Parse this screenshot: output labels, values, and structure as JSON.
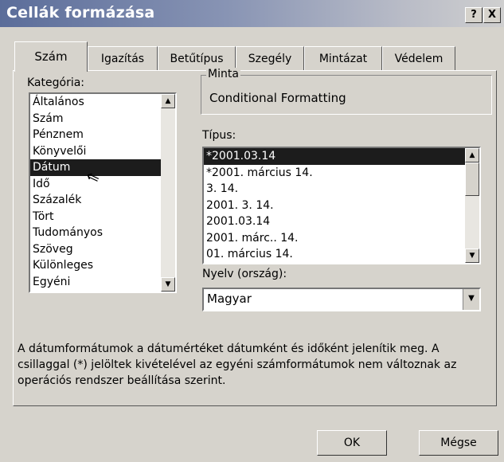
{
  "window": {
    "title": "Cellák formázása",
    "help_label": "?",
    "close_label": "X"
  },
  "tabs": [
    {
      "label": "Szám"
    },
    {
      "label": "Igazítás"
    },
    {
      "label": "Betűtípus"
    },
    {
      "label": "Szegély"
    },
    {
      "label": "Mintázat"
    },
    {
      "label": "Védelem"
    }
  ],
  "category": {
    "label": "Kategória:",
    "items": [
      "Általános",
      "Szám",
      "Pénznem",
      "Könyvelői",
      "Dátum",
      "Idő",
      "Százalék",
      "Tört",
      "Tudományos",
      "Szöveg",
      "Különleges",
      "Egyéni"
    ],
    "selected": "Dátum"
  },
  "sample": {
    "label": "Minta",
    "value": "Conditional Formatting"
  },
  "type": {
    "label": "Típus:",
    "items": [
      "*2001.03.14",
      "*2001. március 14.",
      "3. 14.",
      "2001. 3. 14.",
      "2001.03.14",
      "2001. márc.. 14.",
      "01. március 14."
    ],
    "selected": "*2001.03.14"
  },
  "locale": {
    "label": "Nyelv (ország):",
    "value": "Magyar"
  },
  "description": "A dátumformátumok a dátumértéket dátumként és időként jelenítik meg. A csillaggal (*) jelöltek kivételével az egyéni számformátumok nem változnak az operációs rendszer beállítása szerint.",
  "buttons": {
    "ok": "OK",
    "cancel": "Mégse"
  },
  "icons": {
    "scroll_up": "▲",
    "scroll_down": "▼",
    "cursor": "⇖"
  }
}
